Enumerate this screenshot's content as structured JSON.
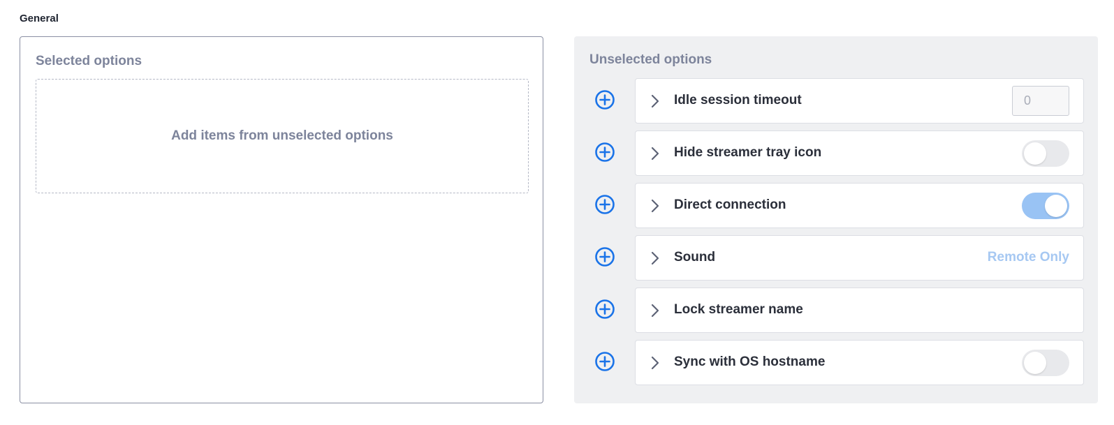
{
  "section": {
    "title": "General"
  },
  "selected": {
    "heading": "Selected options",
    "empty_text": "Add items from unselected options"
  },
  "unselected": {
    "heading": "Unselected options",
    "items": [
      {
        "label": "Idle session timeout",
        "control": "number",
        "placeholder": "0"
      },
      {
        "label": "Hide streamer tray icon",
        "control": "toggle",
        "on": false
      },
      {
        "label": "Direct connection",
        "control": "toggle",
        "on": true
      },
      {
        "label": "Sound",
        "control": "text",
        "value": "Remote Only"
      },
      {
        "label": "Lock streamer name",
        "control": "none"
      },
      {
        "label": "Sync with OS hostname",
        "control": "toggle",
        "on": false
      }
    ]
  },
  "icons": {
    "add": "plus-circle-icon",
    "expand": "chevron-right-icon"
  },
  "colors": {
    "accent": "#1a73e8",
    "toggle_on": "#99c3f4",
    "toggle_off": "#e8e9ec",
    "muted_heading": "#7d849b",
    "value_text": "#a6c8f2"
  }
}
